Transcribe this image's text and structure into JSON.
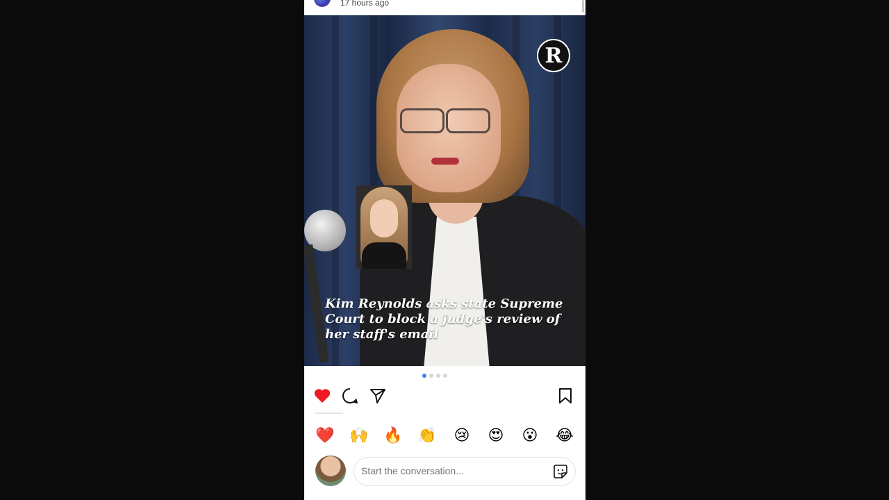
{
  "post": {
    "time_ago": "17 hours ago",
    "image": {
      "headline": "Kim Reynolds asks state Supreme Court to block a judge's review of her staff's email",
      "logo_letter": "R"
    },
    "carousel": {
      "count": 4,
      "active_index": 0
    }
  },
  "actions": {
    "like_icon": "heart-filled-icon",
    "comment_icon": "comment-icon",
    "share_icon": "paper-plane-icon",
    "save_icon": "bookmark-icon",
    "like_color": "#ed1c24"
  },
  "reactions": [
    "❤️",
    "🙌",
    "🔥",
    "👏",
    "😢",
    "😍",
    "😮",
    "😂"
  ],
  "comment": {
    "placeholder": "Start the conversation...",
    "sticker_icon": "sticker-icon"
  }
}
